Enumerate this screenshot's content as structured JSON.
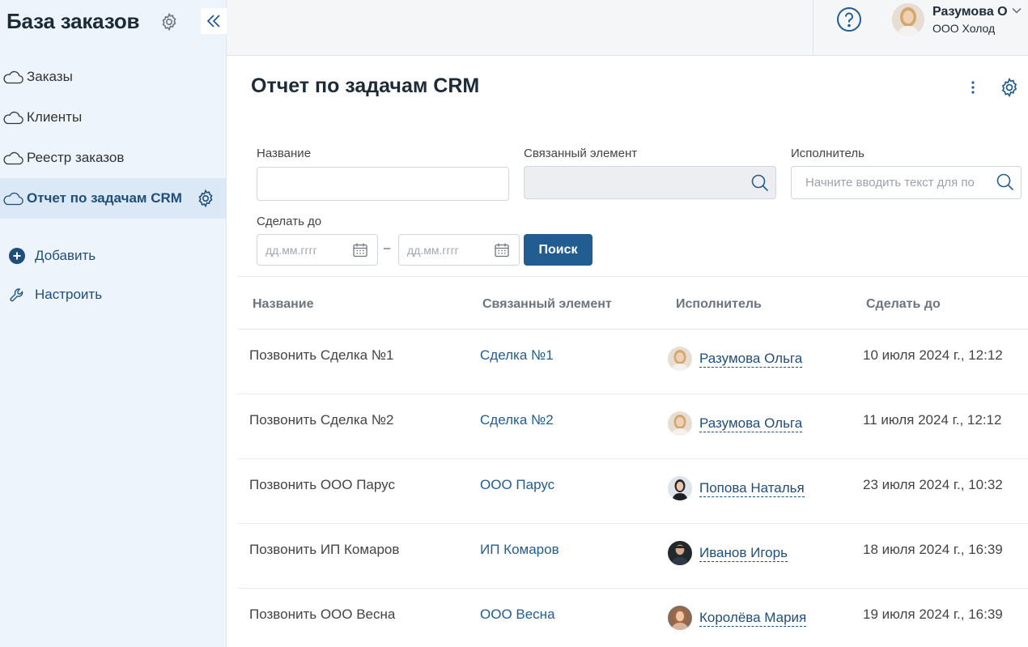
{
  "sidebar": {
    "title": "База заказов",
    "items": [
      {
        "label": "Заказы"
      },
      {
        "label": "Клиенты"
      },
      {
        "label": "Реестр заказов"
      },
      {
        "label": "Отчет по задачам CRM"
      }
    ],
    "actions": {
      "add": "Добавить",
      "configure": "Настроить"
    }
  },
  "topbar": {
    "user_name": "Разумова О",
    "user_company": "ООО Холод"
  },
  "page": {
    "title": "Отчет по задачам CRM"
  },
  "filters": {
    "name_label": "Название",
    "name_value": "",
    "linked_label": "Связанный элемент",
    "linked_value": "",
    "assignee_label": "Исполнитель",
    "assignee_placeholder": "Начните вводить текст для по",
    "due_label": "Сделать до",
    "date_from_placeholder": "дд.мм.гггг",
    "date_to_placeholder": "дд.мм.гггг",
    "date_separator": "–",
    "search_button": "Поиск"
  },
  "table": {
    "columns": [
      "Название",
      "Связанный элемент",
      "Исполнитель",
      "Сделать до"
    ],
    "rows": [
      {
        "name": "Позвонить Сделка №1",
        "linked": "Сделка №1",
        "assignee": "Разумова Ольга",
        "due": "10 июля 2024 г., 12:12"
      },
      {
        "name": "Позвонить Сделка №2",
        "linked": "Сделка №2",
        "assignee": "Разумова Ольга",
        "due": "11 июля 2024 г., 12:12"
      },
      {
        "name": "Позвонить ООО Парус",
        "linked": "ООО Парус",
        "assignee": "Попова Наталья",
        "due": "23 июля 2024 г., 10:32"
      },
      {
        "name": "Позвонить ИП Комаров",
        "linked": "ИП Комаров",
        "assignee": "Иванов Игорь",
        "due": "18 июля 2024 г., 16:39"
      },
      {
        "name": "Позвонить ООО Весна",
        "linked": "ООО Весна",
        "assignee": "Королёва Мария",
        "due": "19 июля 2024 г., 16:39"
      }
    ]
  },
  "colors": {
    "accent": "#225d92",
    "sidebar_bg": "#eef4fb",
    "active_item_bg": "#dbe8f6",
    "title_text": "#1d2b39"
  }
}
